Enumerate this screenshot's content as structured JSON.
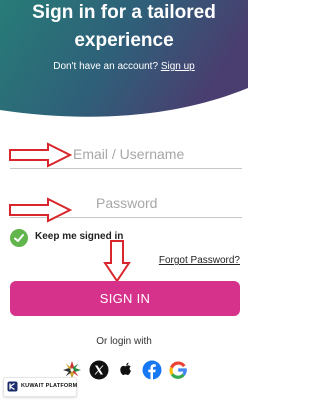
{
  "header": {
    "title_line1": "Sign in for a tailored",
    "title_line2": "experience",
    "no_account_text": "Don't have an account?",
    "signup_link": "Sign up",
    "gradient_colors": [
      "#277c78",
      "#2f5f79",
      "#4a3d6f"
    ]
  },
  "form": {
    "email_placeholder": "Email / Username",
    "password_placeholder": "Password",
    "keep_signed_in_label": "Keep me signed in",
    "keep_signed_in_checked": true,
    "forgot_password_link": "Forgot Password?",
    "signin_button": "SIGN IN",
    "button_color": "#d6328b",
    "checkbox_color": "#62b54c"
  },
  "social": {
    "or_login_with": "Or login with",
    "providers": [
      "uae-pass-icon",
      "x-icon",
      "apple-icon",
      "facebook-icon",
      "google-icon"
    ]
  },
  "watermark": {
    "label": "KUWAIT PLATFORM"
  },
  "annotations": {
    "arrow_color": "#d9262c"
  }
}
